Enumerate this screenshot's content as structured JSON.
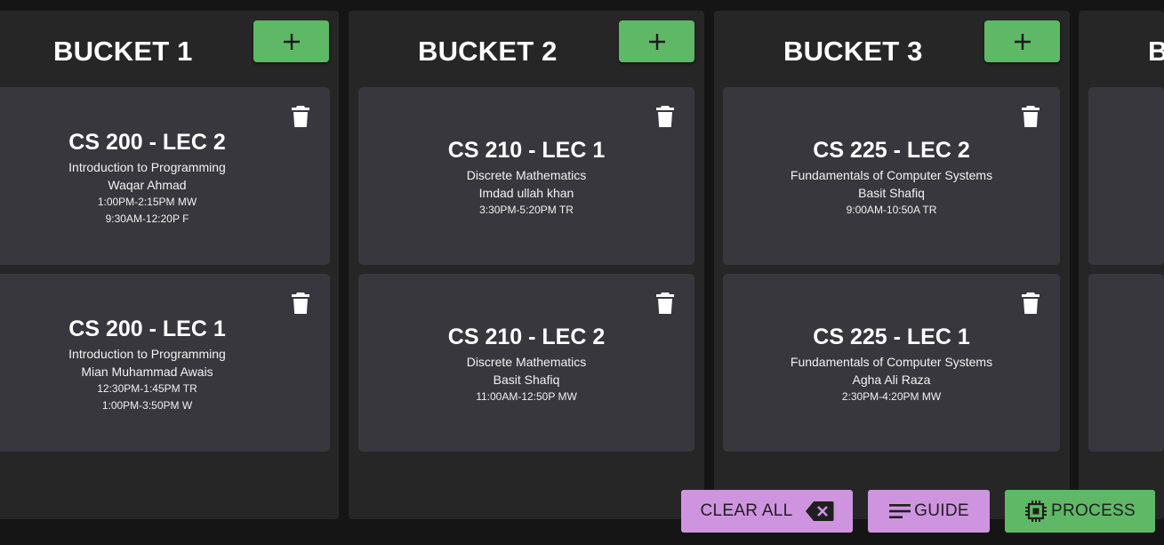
{
  "colors": {
    "background": "#151515",
    "bucket_bg": "#262626",
    "card_bg": "#38373d",
    "accent_green": "#5fb865",
    "accent_purple": "#cf94df"
  },
  "buckets": [
    {
      "title": "BUCKET 1",
      "add_icon": "plus-icon",
      "cards": [
        {
          "course": "CS 200 - LEC 2",
          "name": "Introduction to Programming",
          "instructor": "Waqar Ahmad",
          "times": [
            "1:00PM-2:15PM MW",
            "9:30AM-12:20P F"
          ]
        },
        {
          "course": "CS 200 - LEC 1",
          "name": "Introduction to Programming",
          "instructor": "Mian Muhammad Awais",
          "times": [
            "12:30PM-1:45PM TR",
            "1:00PM-3:50PM W"
          ]
        }
      ]
    },
    {
      "title": "BUCKET 2",
      "add_icon": "plus-icon",
      "cards": [
        {
          "course": "CS 210 - LEC 1",
          "name": "Discrete Mathematics",
          "instructor": "Imdad ullah khan",
          "times": [
            "3:30PM-5:20PM TR"
          ]
        },
        {
          "course": "CS 210 - LEC 2",
          "name": "Discrete Mathematics",
          "instructor": "Basit Shafiq",
          "times": [
            "11:00AM-12:50P MW"
          ]
        }
      ]
    },
    {
      "title": "BUCKET 3",
      "add_icon": "plus-icon",
      "cards": [
        {
          "course": "CS 225 - LEC 2",
          "name": "Fundamentals of Computer Systems",
          "instructor": "Basit Shafiq",
          "times": [
            "9:00AM-10:50A TR"
          ]
        },
        {
          "course": "CS 225 - LEC 1",
          "name": "Fundamentals of Computer Systems",
          "instructor": "Agha Ali Raza",
          "times": [
            "2:30PM-4:20PM MW"
          ]
        }
      ]
    },
    {
      "title": "B",
      "add_icon": "plus-icon",
      "cards": [
        {
          "course": "",
          "name": "",
          "instructor": "",
          "times": []
        },
        {
          "course": "",
          "name": "",
          "instructor": "",
          "times": []
        }
      ]
    }
  ],
  "card_icon": "trash-icon",
  "actions": {
    "clear_all": "CLEAR ALL",
    "clear_icon": "backspace-icon",
    "guide": "GUIDE",
    "guide_icon": "lines-icon",
    "process": "PROCESS",
    "process_icon": "chip-icon"
  }
}
